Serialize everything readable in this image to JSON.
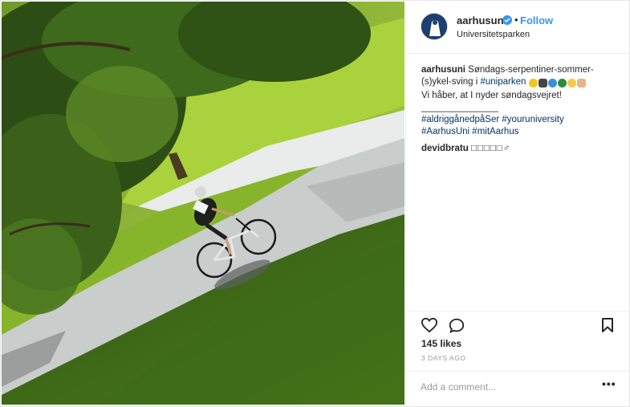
{
  "post": {
    "image_alt": "Cyclist riding a serpentine path through a sunlit park",
    "header": {
      "username": "aarhusuni",
      "dot": "•",
      "follow_label": "Follow",
      "location": "Universitetsparken"
    },
    "caption": {
      "username": "aarhusuni",
      "text_1": " Søndags-serpentiner-sommer-(s)ykel-sving i ",
      "tag_1": "#uniparken",
      "line_2": "Vi håber, at I nyder søndagsvejret!",
      "separator": "_______________",
      "tags_line_3": [
        "#aldriggånedpåSer",
        "#youruniversity"
      ],
      "tags_line_4": [
        "#AarhusUni",
        "#mitAarhus"
      ]
    },
    "comments": [
      {
        "username": "devidbratu",
        "text": "□□□□□♂"
      }
    ],
    "likes": "145 likes",
    "timestamp": "3 DAYS AGO",
    "add_comment_placeholder": "Add a comment...",
    "more_label": "•••"
  },
  "icons": {
    "verified": "verified-badge-icon",
    "like": "heart-icon",
    "comment": "speech-bubble-icon",
    "save": "bookmark-icon",
    "more": "more-options-icon"
  },
  "colors": {
    "link": "#3897f0",
    "hashtag": "#003569",
    "muted": "#999999",
    "text": "#262626"
  }
}
